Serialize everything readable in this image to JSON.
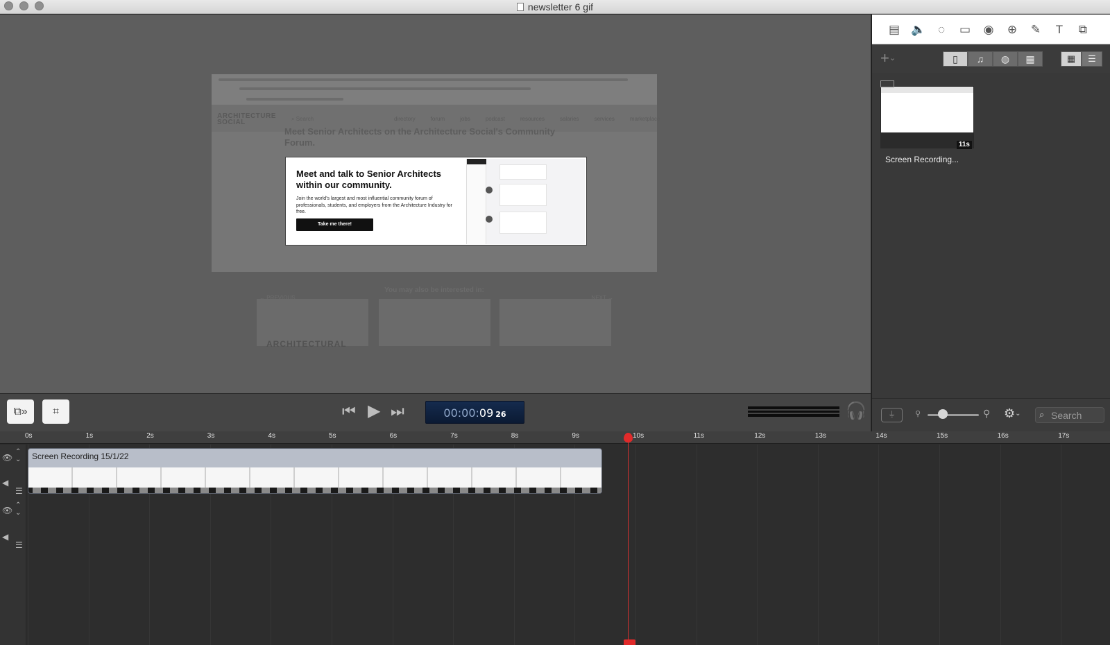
{
  "window": {
    "title": "newsletter 6 gif"
  },
  "canvas": {
    "site_logo_line1": "ARCHITECTURE",
    "site_logo_line2": "SOCIAL",
    "site_search": "Search",
    "site_menu": [
      "directory",
      "forum",
      "jobs",
      "podcast",
      "resources",
      "salaries",
      "services",
      "marketplace"
    ],
    "article_heading": "Meet Senior Architects on the Architecture Social's Community Forum.",
    "promo_heading": "Meet and talk to Senior Architects within our community.",
    "promo_body": "Join the world's largest and most influential community forum of professionals, students, and employers from the Architecture Industry for free.",
    "promo_button": "Take me there!",
    "pager_previous": "PREVIOUS",
    "pager_next": "NEXT",
    "also_interested": "You may also be interested in:",
    "thumb_text": "ARCHITECTURAL"
  },
  "media_library": {
    "items": [
      {
        "label": "Screen Recording...",
        "duration": "11s"
      }
    ],
    "search_placeholder": "Search"
  },
  "transport": {
    "timecode_dim": "00:00:",
    "timecode_seconds": "09",
    "timecode_frames": "26"
  },
  "timeline": {
    "ticks": [
      "0s",
      "1s",
      "2s",
      "3s",
      "4s",
      "5s",
      "6s",
      "7s",
      "8s",
      "9s",
      "10s",
      "11s",
      "12s",
      "13s",
      "14s",
      "15s",
      "16s",
      "17s"
    ],
    "clip_title": "Screen Recording 15/1/22",
    "playhead_seconds": 9.87
  },
  "icons": {
    "inspector": [
      "video-icon",
      "audio-icon",
      "clock-icon",
      "screen-icon",
      "cursor-icon",
      "overlap-icon",
      "pencil-icon",
      "text-icon",
      "transform-icon"
    ],
    "library_segments": [
      "book-icon",
      "music-icon",
      "globe-icon",
      "grid-calendar-icon"
    ]
  },
  "colors": {
    "playhead": "#e12a2a",
    "timecode_bg": "#0b1a33"
  }
}
